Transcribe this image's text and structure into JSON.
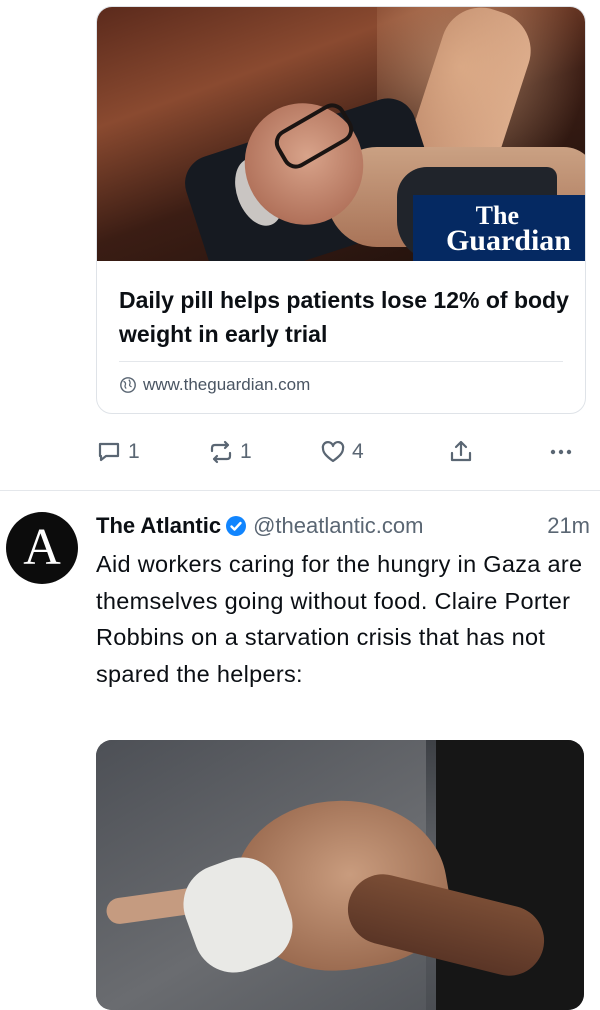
{
  "post1": {
    "link_card": {
      "image_alt": "Man lying on a medical scan table",
      "logo_line1": "The",
      "logo_line2": "Guardian",
      "title": "Daily pill helps patients lose 12% of body weight in early trial",
      "domain": "www.theguardian.com"
    },
    "actions": {
      "reply_count": "1",
      "repost_count": "1",
      "like_count": "4"
    }
  },
  "post2": {
    "avatar_letter": "A",
    "display_name": "The Atlantic",
    "handle": "@theatlantic.com",
    "time": "21m",
    "text": "Aid workers caring for the hungry in Gaza are themselves going without food. Claire Porter Robbins on a starvation crisis that has not spared the helpers:"
  },
  "colors": {
    "accent": "#1185fe",
    "guardian_blue": "#052962",
    "muted": "#5a6673"
  },
  "icons": [
    "globe-icon",
    "reply-icon",
    "repost-icon",
    "like-icon",
    "share-icon",
    "more-icon",
    "verified-icon"
  ]
}
